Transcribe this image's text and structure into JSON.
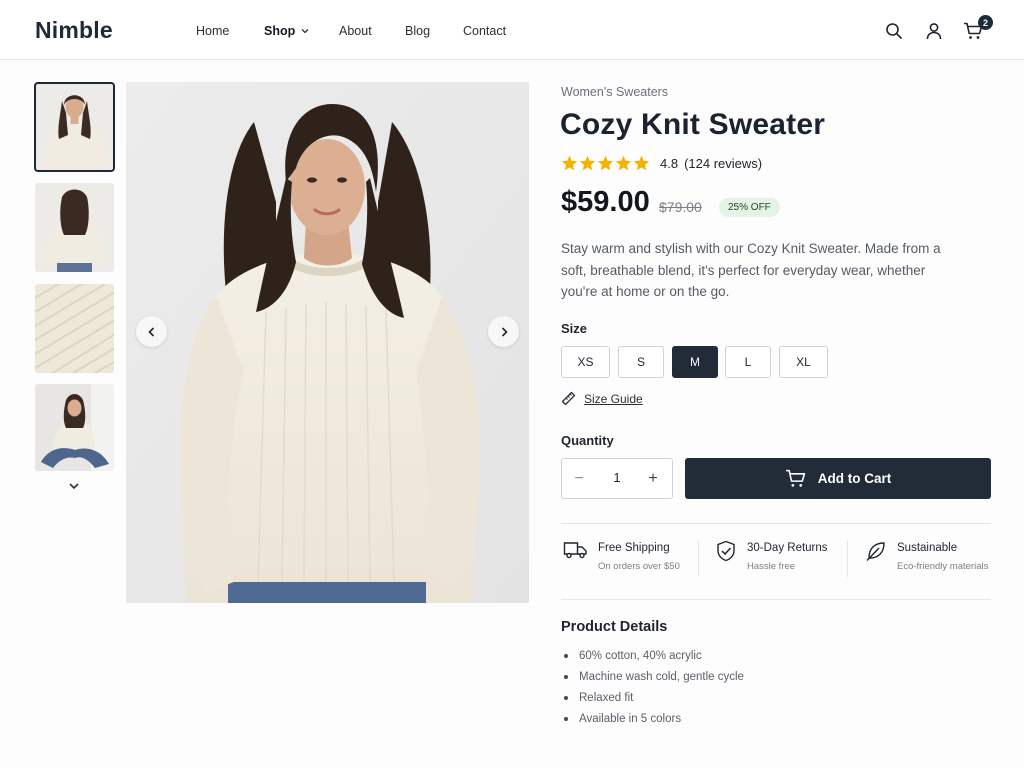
{
  "brand": {
    "logo": "Nimble"
  },
  "nav": [
    {
      "label": "Home",
      "active": false
    },
    {
      "label": "Shop",
      "active": true,
      "has_dropdown": true
    },
    {
      "label": "About",
      "active": false
    },
    {
      "label": "Blog",
      "active": false
    },
    {
      "label": "Contact",
      "active": false
    }
  ],
  "header_icons": [
    "search-icon",
    "user-icon",
    "cart-icon"
  ],
  "cart": {
    "count": "2"
  },
  "gallery": {
    "thumbnails": [
      "front view",
      "back view",
      "knit texture",
      "seated view"
    ],
    "selected_index": 0
  },
  "product": {
    "category": "Women's Sweaters",
    "title": "Cozy Knit Sweater",
    "rating": "4.8",
    "reviews": "(124 reviews)",
    "rating_stars": 5,
    "price": "$59.00",
    "old_price": "$79.00",
    "discount": "25% OFF",
    "description": "Stay warm and stylish with our Cozy Knit Sweater. Made from a soft, breathable blend, it's perfect for everyday wear, whether you're at home or on the go."
  },
  "size": {
    "label": "Size",
    "options": [
      "XS",
      "S",
      "M",
      "L",
      "XL"
    ],
    "selected": "M",
    "guide_label": "Size Guide"
  },
  "quantity": {
    "label": "Quantity",
    "value": "1",
    "minus": "−",
    "plus": "+"
  },
  "add_to_cart": "Add to Cart",
  "features": [
    {
      "title": "Free Shipping",
      "subtitle": "On orders over $50",
      "icon": "truck-icon"
    },
    {
      "title": "30-Day Returns",
      "subtitle": "Hassle free",
      "icon": "shield-check-icon"
    },
    {
      "title": "Sustainable",
      "subtitle": "Eco-friendly materials",
      "icon": "leaf-icon"
    }
  ],
  "details": {
    "title": "Product Details",
    "items": [
      "60% cotton, 40% acrylic",
      "Machine wash cold, gentle cycle",
      "Relaxed fit",
      "Available in 5 colors"
    ]
  },
  "colors": {
    "primary": "#222b38",
    "star": "#f5b301",
    "badge_bg": "#e3f3e6"
  }
}
